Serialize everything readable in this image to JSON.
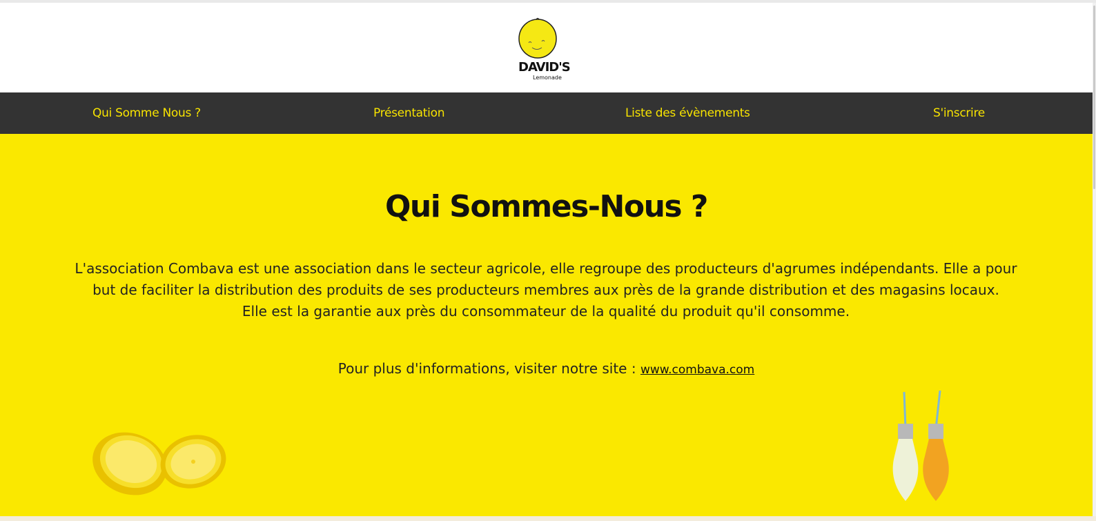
{
  "header": {
    "logo_title": "DAVID'S",
    "logo_subtitle": "Lemonade"
  },
  "nav": {
    "items": [
      {
        "label": "Qui Somme Nous ?"
      },
      {
        "label": "Présentation"
      },
      {
        "label": "Liste des évènements"
      },
      {
        "label": "S'inscrire"
      }
    ]
  },
  "main": {
    "title": "Qui Sommes-Nous ?",
    "paragraph1": "L'association Combava est une association dans le secteur agricole, elle regroupe des producteurs d'agrumes indépendants. Elle a pour but de faciliter la distribution des produits de ses producteurs membres aux près de la grande distribution et des magasins locaux.",
    "paragraph2": "Elle est la garantie aux près du consommateur de la qualité du produit qu'il consomme.",
    "more_info_text": "Pour plus d'informations, visiter notre site : ",
    "site_link": "www.combava.com"
  },
  "colors": {
    "accent": "#fae800",
    "nav_background": "#333333",
    "nav_text": "#f7e300"
  },
  "icons": {
    "logo": "lemon-logo-icon",
    "left_image": "lemon-halves-icon",
    "right_image": "lemonade-bottles-icon"
  }
}
